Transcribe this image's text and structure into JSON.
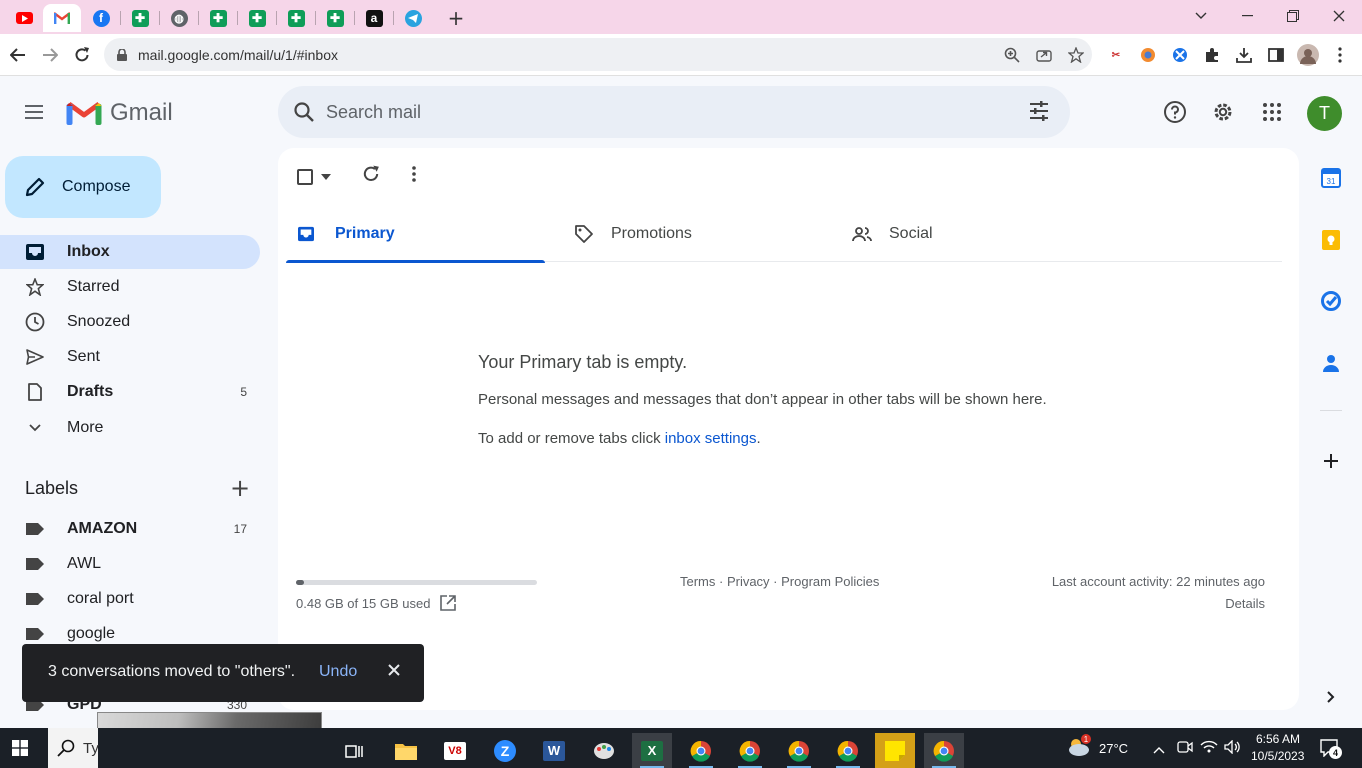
{
  "browser": {
    "tabs": [
      {
        "site": "youtube"
      },
      {
        "site": "gmail",
        "active": true
      },
      {
        "site": "facebook"
      },
      {
        "site": "sheets"
      },
      {
        "site": "globe"
      },
      {
        "site": "sheets"
      },
      {
        "site": "sheets"
      },
      {
        "site": "sheets"
      },
      {
        "site": "sheets"
      },
      {
        "site": "amazon"
      },
      {
        "site": "telegram"
      }
    ],
    "new_tab_glyph": "+",
    "url": "mail.google.com/mail/u/1/#inbox"
  },
  "gmail": {
    "logo_text": "Gmail",
    "search_placeholder": "Search mail",
    "avatar_letter": "T",
    "compose_label": "Compose",
    "nav": [
      {
        "label": "Inbox",
        "icon": "inbox-icon",
        "bold": true,
        "active": true,
        "count": ""
      },
      {
        "label": "Starred",
        "icon": "star-icon",
        "count": ""
      },
      {
        "label": "Snoozed",
        "icon": "clock-icon",
        "count": ""
      },
      {
        "label": "Sent",
        "icon": "send-icon",
        "count": ""
      },
      {
        "label": "Drafts",
        "icon": "draft-icon",
        "bold": true,
        "count": "5"
      },
      {
        "label": "More",
        "icon": "chevron-down-icon",
        "count": ""
      }
    ],
    "labels_heading": "Labels",
    "labels": [
      {
        "label": "AMAZON",
        "bold": true,
        "count": "17"
      },
      {
        "label": "AWL",
        "count": ""
      },
      {
        "label": "coral port",
        "count": ""
      },
      {
        "label": "google",
        "count": ""
      },
      {
        "label": "GPD",
        "bold": true,
        "count": "330"
      }
    ],
    "tabs": [
      {
        "label": "Primary",
        "icon": "inbox-tab-icon",
        "active": true
      },
      {
        "label": "Promotions",
        "icon": "tag-icon"
      },
      {
        "label": "Social",
        "icon": "people-icon"
      }
    ],
    "empty": {
      "title": "Your Primary tab is empty.",
      "line1": "Personal messages and messages that don’t appear in other tabs will be shown here.",
      "line2_prefix": "To add or remove tabs click ",
      "line2_link": "inbox settings",
      "line2_suffix": "."
    },
    "footer": {
      "storage_text": "0.48 GB of 15 GB used",
      "storage_fraction": 0.032,
      "policies": "Terms · Privacy · Program Policies",
      "activity": "Last account activity: 22 minutes ago",
      "details": "Details"
    },
    "snackbar": {
      "message": "3 conversations moved to \"others\".",
      "undo": "Undo"
    }
  },
  "taskbar": {
    "search_text": "Ty",
    "weather_temp": "27°C",
    "weather_badge": "1",
    "time": "6:56 AM",
    "date": "10/5/2023",
    "notification_count": "4"
  },
  "colors": {
    "tabstrip": "#f6d6e9",
    "accent": "#0b57d0",
    "compose": "#c2e7ff",
    "nav_active": "#d3e3fd",
    "avatar": "#3f8d2c"
  }
}
